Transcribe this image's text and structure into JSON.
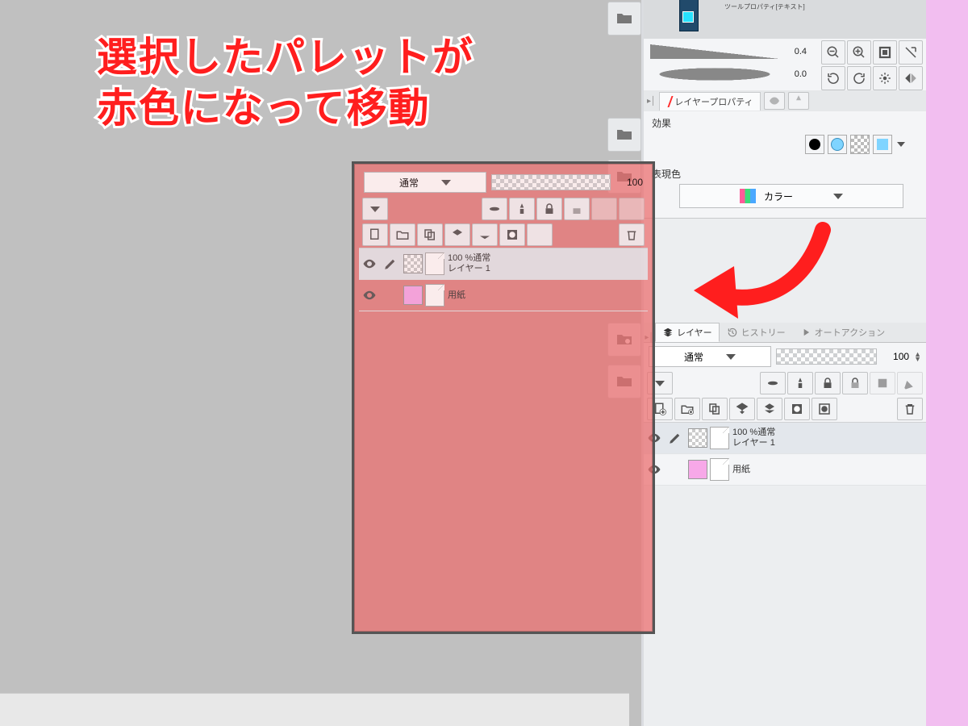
{
  "caption": {
    "line1": "選択したパレットが",
    "line2": "赤色になって移動"
  },
  "brush": {
    "size": "0.4",
    "opacity": "0.0"
  },
  "top_icons": [
    "zoom-out-icon",
    "zoom-in-icon",
    "fit-screen-icon",
    "actual-size-icon",
    "rotate-ccw-icon",
    "rotate-cw-icon",
    "reset-rotation-icon",
    "flip-horizontal-icon"
  ],
  "mini_header": {
    "label": "ツールプロパティ[テキスト]"
  },
  "layer_property": {
    "tab_label": "レイヤープロパティ",
    "section_effect": "効果",
    "section_render": "表現色",
    "render_label": "カラー",
    "fx_swatches": [
      "fx-black",
      "fx-cyan",
      "fx-checker",
      "fx-cyan-fill"
    ]
  },
  "layer_panel": {
    "tabs": [
      {
        "id": "layer",
        "label": "レイヤー",
        "active": true
      },
      {
        "id": "history",
        "label": "ヒストリー",
        "active": false
      },
      {
        "id": "autoaction",
        "label": "オートアクション",
        "active": false
      }
    ],
    "blend_mode": "通常",
    "opacity": "100",
    "row1_icons": [
      "dropdown",
      "disc",
      "lighthouse",
      "lock",
      "lock-alpha",
      "ref-layer",
      "draft-layer"
    ],
    "row2_icons": [
      "new-layer",
      "new-folder",
      "copy-layer",
      "transfer-down",
      "merge-down",
      "mask",
      "apply-mask",
      "trash"
    ],
    "layers": [
      {
        "opacity_text": "100 %通常",
        "name": "レイヤー 1",
        "selected": true,
        "hasBrush": true,
        "swatch": "checker"
      },
      {
        "opacity_text": "",
        "name": "用紙",
        "selected": false,
        "hasBrush": false,
        "swatch": "pink"
      }
    ]
  },
  "dock": [
    "folder",
    "folder-down",
    "folder-right",
    "folder-cog",
    "speech",
    "folder-up"
  ]
}
